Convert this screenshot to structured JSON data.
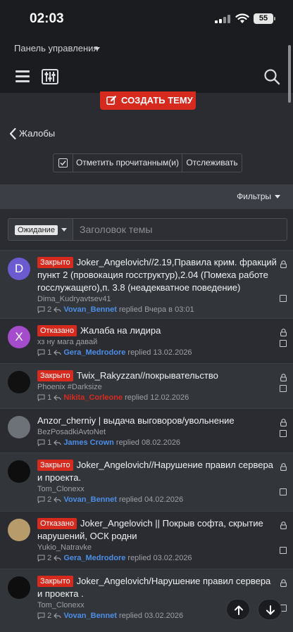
{
  "status": {
    "time": "02:03",
    "battery": "55"
  },
  "control_panel": {
    "label": "Панель управления"
  },
  "nav": {
    "create_label": "СОЗДАТЬ ТЕМУ"
  },
  "breadcrumb": {
    "back_label": "Жалобы"
  },
  "actions": {
    "mark_read": "Отметить прочитанным(и)",
    "follow": "Отслеживать"
  },
  "filters": {
    "label": "Фильтры"
  },
  "title_filter": {
    "prefix": "Ожидание",
    "placeholder": "Заголовок темы"
  },
  "threads": [
    {
      "avatar_letter": "D",
      "avatar_color": "#6c5bd0",
      "status": "Закрыто",
      "title": "Joker_Angelovich//2.19,Правила крим. фракций пункт 2 (провокация госструктур),2.04 (Помеха работе госслужащего),п. 3.8 (неадекватное поведение)",
      "author": "Dima_Kudryavtsev41",
      "replies": "2",
      "last_user": "Vovan_Bennet",
      "replied_text": "replied",
      "date": "Вчера в 03:01"
    },
    {
      "avatar_letter": "X",
      "avatar_color": "#a54ccc",
      "status": "Отказано",
      "title": "Жалаба на лидира",
      "author": "хз ну мага давай",
      "replies": "1",
      "last_user": "Gera_Medrodore",
      "replied_text": "replied",
      "date": "13.02.2026"
    },
    {
      "avatar_letter": "",
      "avatar_color": "#111111",
      "status": "Закрыто",
      "title": "Twix_Rakyzzan//покрывательство",
      "author": "Phoenix #Darksize",
      "replies": "1",
      "last_user": "Nikita_Corleone",
      "replied_text": "replied",
      "date": "12.02.2026"
    },
    {
      "avatar_letter": "",
      "avatar_color": "#6d7178",
      "status": "",
      "title": "Anzor_cherniy | выдача выговоров/увольнение",
      "author": "BezPosadkiAvtoNet",
      "replies": "1",
      "last_user": "James Crown",
      "replied_text": "replied",
      "date": "08.02.2026"
    },
    {
      "avatar_letter": "",
      "avatar_color": "#0e0e0e",
      "status": "Закрыто",
      "title": "Joker_Angelovich//Нарушение правил сервера и проекта.",
      "author": "Tom_Clonexx",
      "replies": "2",
      "last_user": "Vovan_Bennet",
      "replied_text": "replied",
      "date": "04.02.2026"
    },
    {
      "avatar_letter": "",
      "avatar_color": "#b79b6a",
      "status": "Отказано",
      "title": "Joker_Angelovich || Покрыв софта, скрытие нарушений, ОСК родни",
      "author": "Yukio_Natravke",
      "replies": "2",
      "last_user": "Gera_Medrodore",
      "replied_text": "replied",
      "date": "03.02.2026"
    },
    {
      "avatar_letter": "",
      "avatar_color": "#0e0e0e",
      "status": "Закрыто",
      "title": "Joker_Angelovich/Нарушение правил сервера и проекта .",
      "author": "Tom_Clonexx",
      "replies": "2",
      "last_user": "Vovan_Bennet",
      "replied_text": "replied",
      "date": "03.02.2026"
    }
  ],
  "colors": {
    "accent_red": "#d62a1f",
    "link_blue": "#4d8ee6",
    "background": "#2a2c31"
  }
}
